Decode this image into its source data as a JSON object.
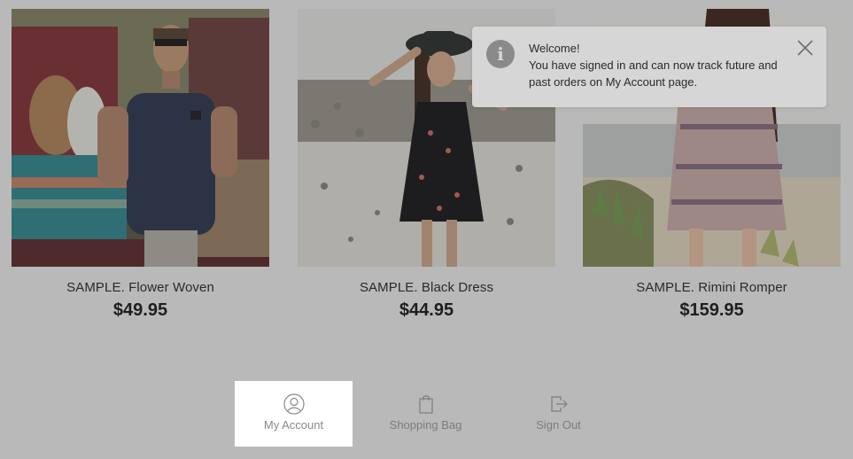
{
  "products": [
    {
      "name": "SAMPLE. Flower Woven",
      "price": "$49.95"
    },
    {
      "name": "SAMPLE. Black Dress",
      "price": "$44.95"
    },
    {
      "name": "SAMPLE. Rimini Romper",
      "price": "$159.95"
    }
  ],
  "toast": {
    "title": "Welcome!",
    "message": "You have signed in and can now track future and past orders on My Account page.",
    "icon": "info-icon",
    "close_icon": "close-icon"
  },
  "nav": {
    "my_account": "My Account",
    "shopping_bag": "Shopping Bag",
    "sign_out": "Sign Out",
    "active": "my_account"
  },
  "colors": {
    "overlay": "#b9b9b9",
    "toast_bg": "#d6d6d6",
    "active_tab_bg": "#ffffff"
  }
}
